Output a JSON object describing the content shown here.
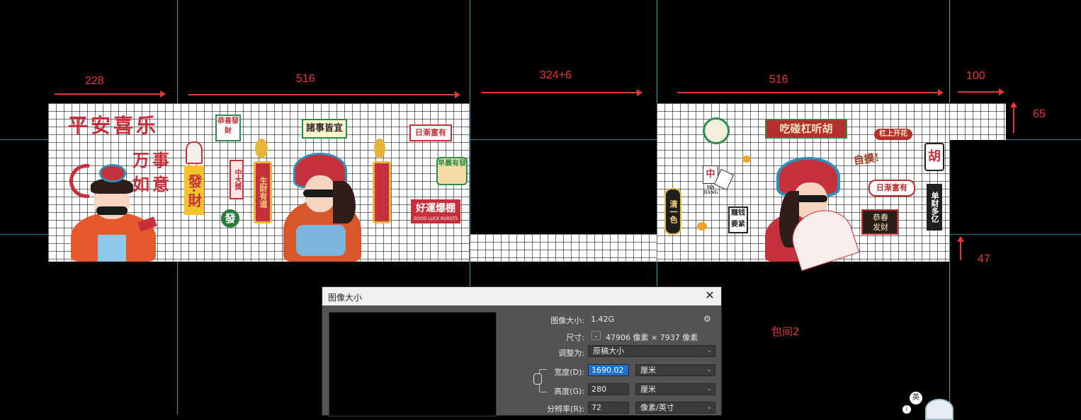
{
  "dimensions": {
    "seg1": "228",
    "seg2": "516",
    "seg3": "324+6",
    "seg4": "516",
    "seg5": "100",
    "height_top": "65",
    "height_bottom": "47"
  },
  "room_label": "包间2",
  "wall_texts": {
    "ping_an": "平安喜乐",
    "wan_shi": "万事",
    "ru_yi": "如意",
    "gong_xi": "恭喜發財",
    "fa_cai": "發·財",
    "fa": "發",
    "zhong_da_jiang": "中大獎",
    "sheng_cai": "生財有道",
    "zhu_shi": "諸事皆宜",
    "ri_jian": "日漸富有",
    "zao_an": "早晨有發",
    "hao_yun": "好運爆棚",
    "hao_yun_sub": "GOOD LUCK BURSTS",
    "chi_peng": "吃碰杠听胡",
    "gang_shang": "杠上开花",
    "zi_mo": "自摸!",
    "hu": "胡",
    "ri_jian_2": "日渐富有",
    "qing_yi_se": "清一色",
    "zhong": "中",
    "ma_jiang": "MA JIANG",
    "zhuan_qian": "赚钱要紧",
    "gong_chun": "恭春发财",
    "wan": "单财多亿"
  },
  "dialog": {
    "title": "图像大小",
    "close_icon": "close-icon",
    "size_label": "图像大小:",
    "size_value": "1.42G",
    "dims_label": "尺寸:",
    "dims_value": "47906 像素 × 7937 像素",
    "fit_label": "调整为:",
    "fit_value": "原稿大小",
    "width_label": "宽度(D):",
    "width_value": "1690.02",
    "width_unit": "厘米",
    "height_label": "高度(G):",
    "height_value": "280",
    "height_unit": "厘米",
    "res_label": "分辨率(R):",
    "res_value": "72",
    "res_unit": "像素/英寸"
  },
  "tray": {
    "ime": "英"
  }
}
